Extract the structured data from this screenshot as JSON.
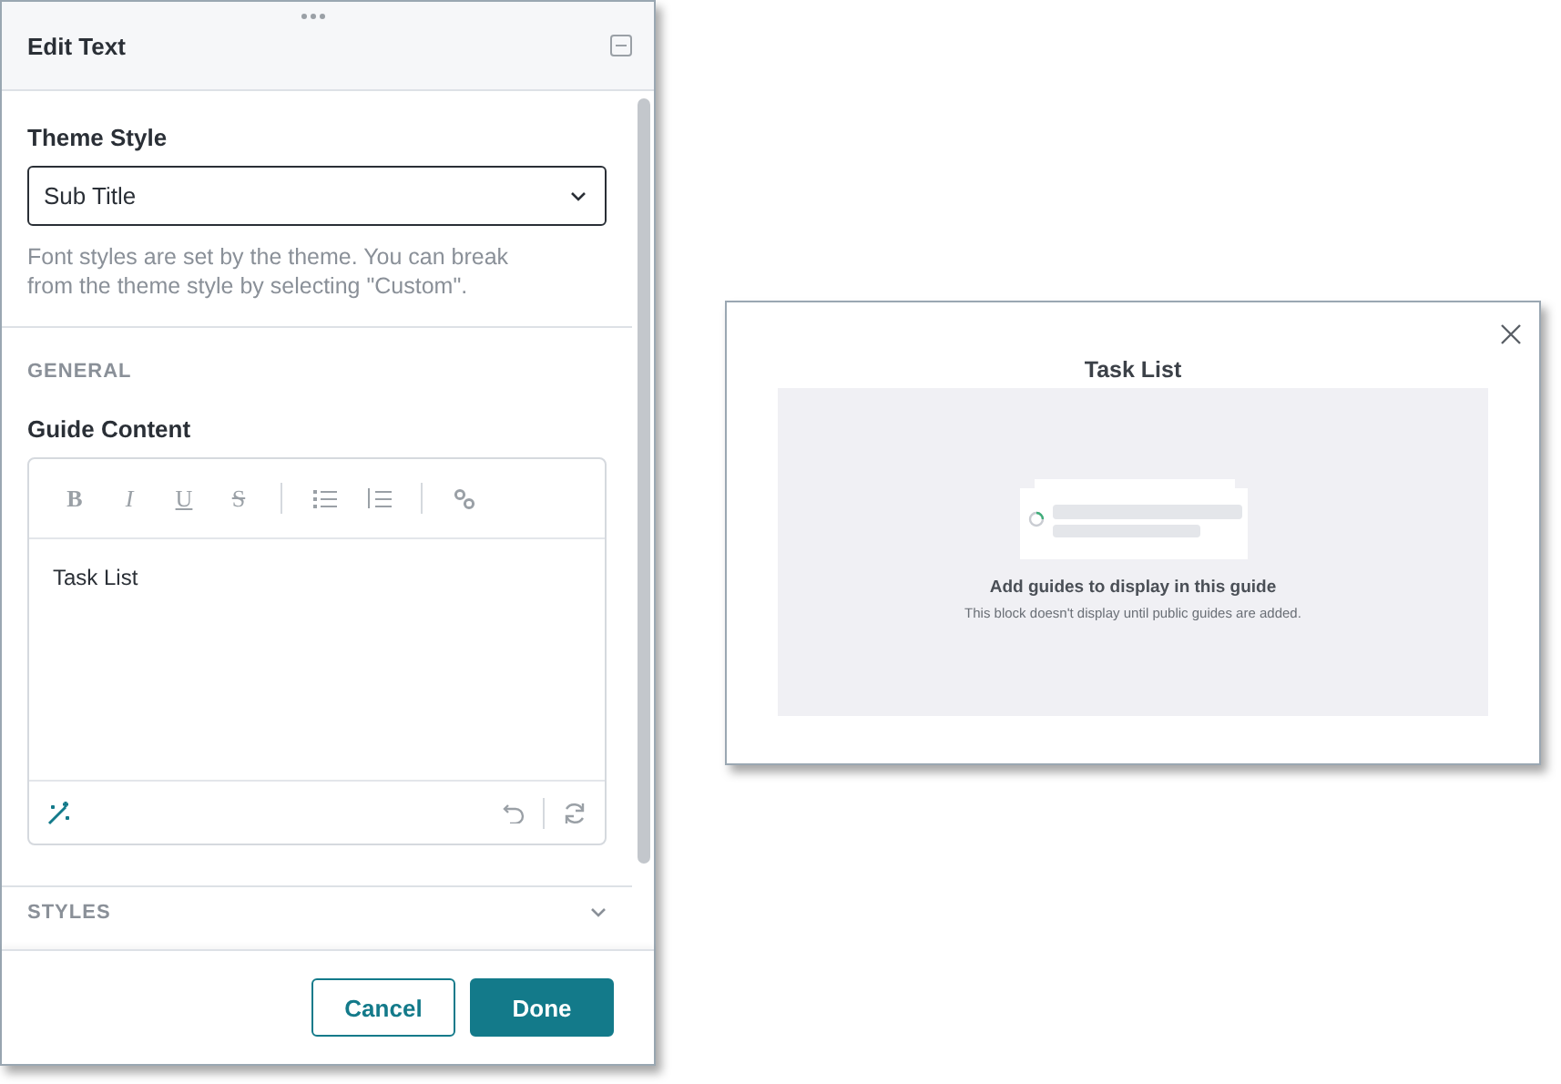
{
  "panel": {
    "title": "Edit Text",
    "theme_style": {
      "label": "Theme Style",
      "value": "Sub Title",
      "help": "Font styles are set by the theme. You can break from the theme style by selecting \"Custom\"."
    },
    "general": {
      "heading": "GENERAL",
      "label": "Guide Content",
      "format_buttons": [
        {
          "kind": "bold",
          "text": "B"
        },
        {
          "kind": "italic",
          "text": "I"
        },
        {
          "kind": "underline",
          "text": "U"
        },
        {
          "kind": "strike",
          "text": "S"
        },
        {
          "kind": "bullets"
        },
        {
          "kind": "numbers"
        },
        {
          "kind": "link"
        }
      ],
      "content": "Task List"
    },
    "styles": {
      "heading": "STYLES",
      "expanded": false
    },
    "buttons": [
      {
        "label": "Cancel",
        "kind": "secondary"
      },
      {
        "label": "Done",
        "kind": "primary"
      }
    ]
  },
  "preview": {
    "title": "Task List",
    "empty_title": "Add guides to display in this guide",
    "empty_text": "This block doesn't display until public guides are added."
  }
}
